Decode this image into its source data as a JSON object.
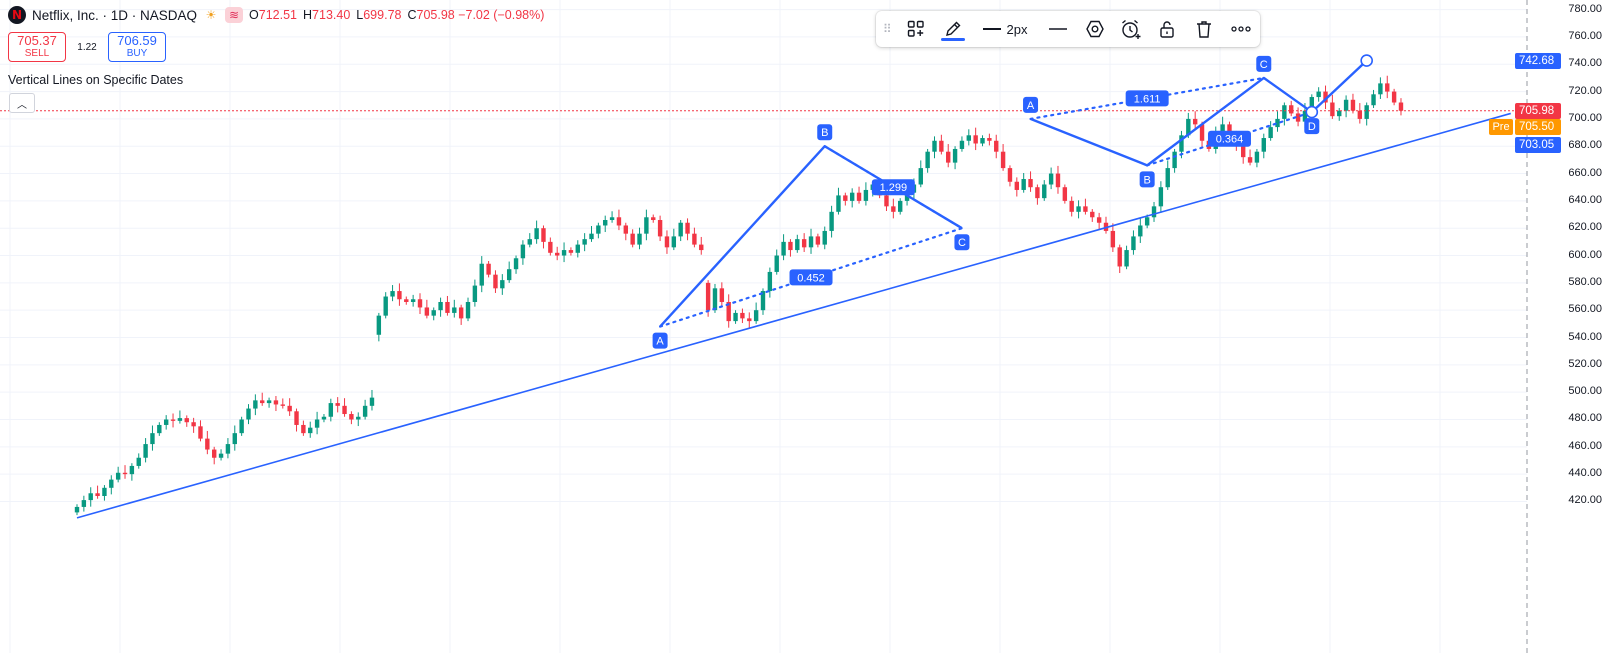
{
  "header": {
    "logo_letter": "N",
    "symbol": "Netflix, Inc. · 1D · NASDAQ",
    "sun_icon": "sun-icon",
    "wave_icon": "wave-icon",
    "ohlc": [
      {
        "key": "O",
        "value": "712.51"
      },
      {
        "key": "H",
        "value": "713.40"
      },
      {
        "key": "L",
        "value": "699.78"
      },
      {
        "key": "C",
        "value": "705.98 −7.02 (−0.98%)"
      }
    ]
  },
  "trade": {
    "sell_price": "705.37",
    "sell_label": "SELL",
    "spread": "1.22",
    "buy_price": "706.59",
    "buy_label": "BUY"
  },
  "indicator": {
    "title": "Vertical Lines on Specific Dates",
    "collapse_icon": "chevron-up-icon"
  },
  "toolbar": {
    "width_label": "2px",
    "icons": [
      "drag-handle-icon",
      "template-icon",
      "pencil-icon",
      "line-width-icon",
      "line-style-icon",
      "hexagon-icon",
      "alarm-add-icon",
      "lock-icon",
      "trash-icon",
      "more-icon"
    ]
  },
  "price_axis": {
    "ticks": [
      "780.00",
      "760.00",
      "740.00",
      "720.00",
      "700.00",
      "680.00",
      "660.00",
      "640.00",
      "620.00",
      "600.00",
      "580.00",
      "560.00",
      "540.00",
      "520.00",
      "500.00",
      "480.00",
      "460.00",
      "440.00",
      "420.00"
    ],
    "labels": [
      {
        "text": "742.68",
        "price": 742.68,
        "color": "#2962ff"
      },
      {
        "text": "705.98",
        "price": 705.98,
        "color": "#f23645"
      },
      {
        "text": "705.50",
        "price": 705.5,
        "color": "#ff9800",
        "prefix": "Pre"
      },
      {
        "text": "703.05",
        "price": 703.05,
        "color": "#2962ff"
      }
    ],
    "last_price": 705.98,
    "colors": {
      "up": "#089981",
      "down": "#f23645",
      "drawing": "#2962ff",
      "grid": "#f0f3fa"
    }
  },
  "chart_data": {
    "type": "candlestick",
    "symbol": "NFLX",
    "interval": "1D",
    "ylim": [
      410,
      788
    ],
    "series": [
      {
        "name": "price",
        "points": [
          {
            "o": 412,
            "c": 416
          },
          {
            "o": 416,
            "c": 421
          },
          {
            "o": 421,
            "c": 426
          },
          {
            "o": 426,
            "c": 424
          },
          {
            "o": 424,
            "c": 430
          },
          {
            "o": 430,
            "c": 436
          },
          {
            "o": 436,
            "c": 441
          },
          {
            "o": 441,
            "c": 440
          },
          {
            "o": 440,
            "c": 446
          },
          {
            "o": 446,
            "c": 452
          },
          {
            "o": 452,
            "c": 462
          },
          {
            "o": 462,
            "c": 470
          },
          {
            "o": 470,
            "c": 476
          },
          {
            "o": 476,
            "c": 480
          },
          {
            "o": 480,
            "c": 479
          },
          {
            "o": 479,
            "c": 481
          },
          {
            "o": 481,
            "c": 478
          },
          {
            "o": 478,
            "c": 475
          },
          {
            "o": 475,
            "c": 466
          },
          {
            "o": 466,
            "c": 458
          },
          {
            "o": 458,
            "c": 452
          },
          {
            "o": 452,
            "c": 455
          },
          {
            "o": 455,
            "c": 462
          },
          {
            "o": 462,
            "c": 470
          },
          {
            "o": 470,
            "c": 480
          },
          {
            "o": 480,
            "c": 488
          },
          {
            "o": 488,
            "c": 494
          },
          {
            "o": 494,
            "c": 492
          },
          {
            "o": 492,
            "c": 494
          },
          {
            "o": 494,
            "c": 491
          },
          {
            "o": 491,
            "c": 490
          },
          {
            "o": 490,
            "c": 486
          },
          {
            "o": 486,
            "c": 476
          },
          {
            "o": 476,
            "c": 470
          },
          {
            "o": 470,
            "c": 474
          },
          {
            "o": 474,
            "c": 480
          },
          {
            "o": 480,
            "c": 482
          },
          {
            "o": 482,
            "c": 492
          },
          {
            "o": 492,
            "c": 490
          },
          {
            "o": 490,
            "c": 484
          },
          {
            "o": 484,
            "c": 480
          },
          {
            "o": 480,
            "c": 482
          },
          {
            "o": 482,
            "c": 490
          },
          {
            "o": 490,
            "c": 496
          },
          {
            "o": 542,
            "c": 556
          },
          {
            "o": 556,
            "c": 570
          },
          {
            "o": 570,
            "c": 574
          },
          {
            "o": 574,
            "c": 568
          },
          {
            "o": 568,
            "c": 566
          },
          {
            "o": 566,
            "c": 568
          },
          {
            "o": 568,
            "c": 562
          },
          {
            "o": 562,
            "c": 556
          },
          {
            "o": 556,
            "c": 560
          },
          {
            "o": 560,
            "c": 566
          },
          {
            "o": 566,
            "c": 558
          },
          {
            "o": 558,
            "c": 562
          },
          {
            "o": 562,
            "c": 554
          },
          {
            "o": 554,
            "c": 566
          },
          {
            "o": 566,
            "c": 578
          },
          {
            "o": 578,
            "c": 594
          },
          {
            "o": 594,
            "c": 586
          },
          {
            "o": 586,
            "c": 576
          },
          {
            "o": 576,
            "c": 582
          },
          {
            "o": 582,
            "c": 590
          },
          {
            "o": 590,
            "c": 598
          },
          {
            "o": 598,
            "c": 608
          },
          {
            "o": 608,
            "c": 612
          },
          {
            "o": 612,
            "c": 620
          },
          {
            "o": 620,
            "c": 610
          },
          {
            "o": 610,
            "c": 602
          },
          {
            "o": 602,
            "c": 600
          },
          {
            "o": 600,
            "c": 604
          },
          {
            "o": 604,
            "c": 602
          },
          {
            "o": 602,
            "c": 608
          },
          {
            "o": 608,
            "c": 612
          },
          {
            "o": 612,
            "c": 616
          },
          {
            "o": 616,
            "c": 622
          },
          {
            "o": 622,
            "c": 626
          },
          {
            "o": 626,
            "c": 628
          },
          {
            "o": 628,
            "c": 622
          },
          {
            "o": 622,
            "c": 616
          },
          {
            "o": 616,
            "c": 608
          },
          {
            "o": 608,
            "c": 616
          },
          {
            "o": 616,
            "c": 628
          },
          {
            "o": 628,
            "c": 626
          },
          {
            "o": 626,
            "c": 614
          },
          {
            "o": 614,
            "c": 606
          },
          {
            "o": 606,
            "c": 614
          },
          {
            "o": 614,
            "c": 624
          },
          {
            "o": 624,
            "c": 616
          },
          {
            "o": 616,
            "c": 608
          },
          {
            "o": 608,
            "c": 604
          },
          {
            "o": 580,
            "c": 560
          },
          {
            "o": 560,
            "c": 576
          },
          {
            "o": 576,
            "c": 566
          },
          {
            "o": 566,
            "c": 552
          },
          {
            "o": 552,
            "c": 558
          },
          {
            "o": 558,
            "c": 554
          },
          {
            "o": 554,
            "c": 552
          },
          {
            "o": 552,
            "c": 560
          },
          {
            "o": 560,
            "c": 574
          },
          {
            "o": 574,
            "c": 588
          },
          {
            "o": 588,
            "c": 600
          },
          {
            "o": 600,
            "c": 610
          },
          {
            "o": 610,
            "c": 604
          },
          {
            "o": 604,
            "c": 612
          },
          {
            "o": 612,
            "c": 606
          },
          {
            "o": 606,
            "c": 614
          },
          {
            "o": 614,
            "c": 608
          },
          {
            "o": 608,
            "c": 618
          },
          {
            "o": 618,
            "c": 632
          },
          {
            "o": 632,
            "c": 644
          },
          {
            "o": 644,
            "c": 640
          },
          {
            "o": 640,
            "c": 646
          },
          {
            "o": 646,
            "c": 640
          },
          {
            "o": 640,
            "c": 648
          },
          {
            "o": 648,
            "c": 652
          },
          {
            "o": 652,
            "c": 644
          },
          {
            "o": 644,
            "c": 636
          },
          {
            "o": 636,
            "c": 632
          },
          {
            "o": 632,
            "c": 640
          },
          {
            "o": 640,
            "c": 646
          },
          {
            "o": 646,
            "c": 652
          },
          {
            "o": 652,
            "c": 664
          },
          {
            "o": 664,
            "c": 676
          },
          {
            "o": 676,
            "c": 684
          },
          {
            "o": 684,
            "c": 676
          },
          {
            "o": 676,
            "c": 668
          },
          {
            "o": 668,
            "c": 678
          },
          {
            "o": 678,
            "c": 684
          },
          {
            "o": 684,
            "c": 688
          },
          {
            "o": 688,
            "c": 682
          },
          {
            "o": 682,
            "c": 686
          },
          {
            "o": 686,
            "c": 684
          },
          {
            "o": 684,
            "c": 676
          },
          {
            "o": 676,
            "c": 664
          },
          {
            "o": 664,
            "c": 654
          },
          {
            "o": 654,
            "c": 648
          },
          {
            "o": 648,
            "c": 656
          },
          {
            "o": 656,
            "c": 650
          },
          {
            "o": 650,
            "c": 642
          },
          {
            "o": 642,
            "c": 652
          },
          {
            "o": 652,
            "c": 660
          },
          {
            "o": 660,
            "c": 650
          },
          {
            "o": 650,
            "c": 640
          },
          {
            "o": 640,
            "c": 632
          },
          {
            "o": 632,
            "c": 636
          },
          {
            "o": 636,
            "c": 632
          },
          {
            "o": 632,
            "c": 628
          },
          {
            "o": 628,
            "c": 624
          },
          {
            "o": 624,
            "c": 618
          },
          {
            "o": 618,
            "c": 606
          },
          {
            "o": 606,
            "c": 592
          },
          {
            "o": 592,
            "c": 604
          },
          {
            "o": 604,
            "c": 614
          },
          {
            "o": 614,
            "c": 622
          },
          {
            "o": 622,
            "c": 628
          },
          {
            "o": 628,
            "c": 636
          },
          {
            "o": 636,
            "c": 650
          },
          {
            "o": 650,
            "c": 664
          },
          {
            "o": 664,
            "c": 676
          },
          {
            "o": 676,
            "c": 688
          },
          {
            "o": 688,
            "c": 700
          },
          {
            "o": 700,
            "c": 696
          },
          {
            "o": 696,
            "c": 684
          },
          {
            "o": 684,
            "c": 678
          },
          {
            "o": 678,
            "c": 690
          },
          {
            "o": 690,
            "c": 696
          },
          {
            "o": 696,
            "c": 688
          },
          {
            "o": 688,
            "c": 680
          },
          {
            "o": 680,
            "c": 672
          },
          {
            "o": 672,
            "c": 668
          },
          {
            "o": 668,
            "c": 676
          },
          {
            "o": 676,
            "c": 686
          },
          {
            "o": 686,
            "c": 694
          },
          {
            "o": 694,
            "c": 700
          },
          {
            "o": 700,
            "c": 710
          },
          {
            "o": 710,
            "c": 704
          },
          {
            "o": 704,
            "c": 698
          },
          {
            "o": 698,
            "c": 706
          },
          {
            "o": 706,
            "c": 716
          },
          {
            "o": 716,
            "c": 720
          },
          {
            "o": 720,
            "c": 712
          },
          {
            "o": 712,
            "c": 702
          },
          {
            "o": 702,
            "c": 706
          },
          {
            "o": 706,
            "c": 714
          },
          {
            "o": 714,
            "c": 706
          },
          {
            "o": 706,
            "c": 700
          },
          {
            "o": 700,
            "c": 710
          },
          {
            "o": 710,
            "c": 718
          },
          {
            "o": 718,
            "c": 726
          },
          {
            "o": 726,
            "c": 720
          },
          {
            "o": 720,
            "c": 712
          },
          {
            "o": 712,
            "c": 705.98
          }
        ]
      }
    ],
    "drawings": {
      "trend_line": {
        "start": {
          "bar": 0,
          "price": 408
        },
        "end": {
          "bar": 209,
          "price": 704
        }
      },
      "pattern_1": {
        "points": [
          {
            "label": "A",
            "bar": 85,
            "price": 548
          },
          {
            "label": "B",
            "bar": 109,
            "price": 680
          },
          {
            "label": "C",
            "bar": 129,
            "price": 620
          }
        ],
        "ratios": [
          {
            "text": "0.452",
            "between": [
              "A",
              "C"
            ]
          },
          {
            "text": "1.299",
            "between": [
              "B",
              "C"
            ]
          }
        ]
      },
      "pattern_2": {
        "points": [
          {
            "label": "A",
            "bar": 139,
            "price": 700
          },
          {
            "label": "B",
            "bar": 156,
            "price": 666
          },
          {
            "label": "C",
            "bar": 173,
            "price": 730
          },
          {
            "label": "D",
            "bar": 180,
            "price": 705
          },
          {
            "label": "",
            "bar": 188,
            "price": 742.68
          }
        ],
        "ratios": [
          {
            "text": "1.611",
            "between": [
              "A",
              "C"
            ]
          },
          {
            "text": "0.364",
            "between": [
              "B",
              "D"
            ]
          }
        ]
      }
    }
  }
}
